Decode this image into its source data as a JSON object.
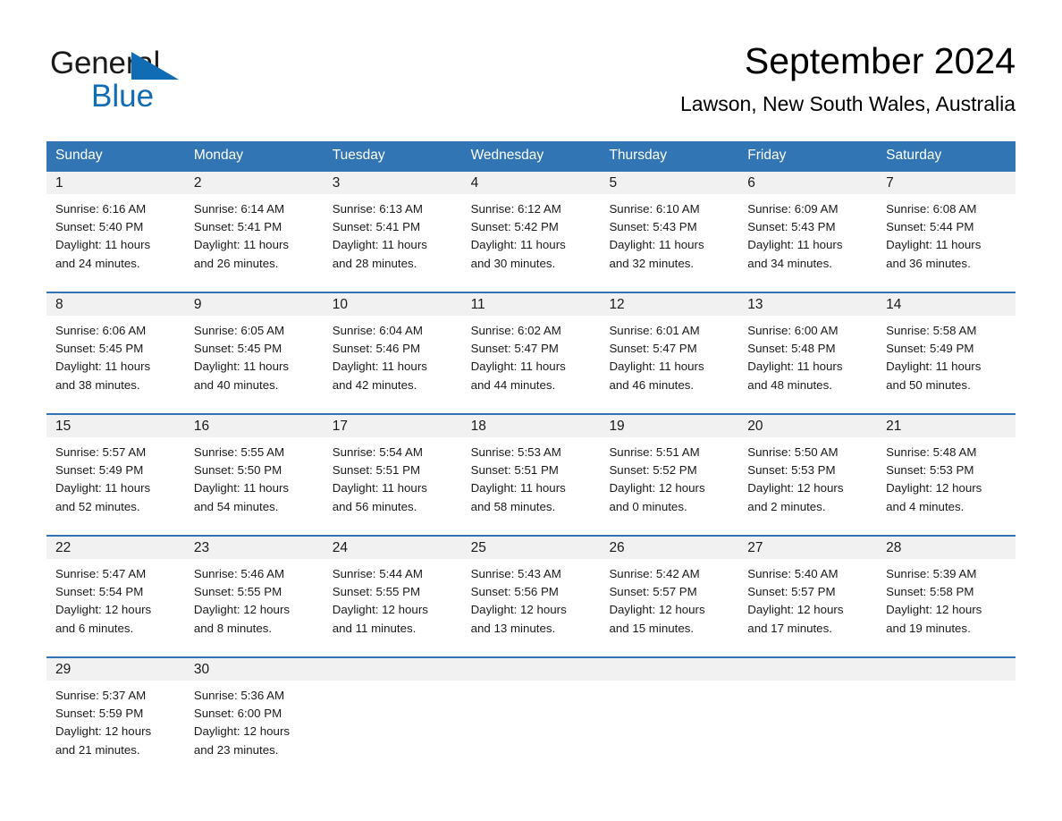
{
  "brand": {
    "name_part1": "General",
    "name_part2": "Blue",
    "triangle_icon": "triangle-icon",
    "accent_color": "#0f6cb5"
  },
  "header": {
    "title": "September 2024",
    "subtitle": "Lawson, New South Wales, Australia"
  },
  "theme": {
    "header_blue": "#3275b4",
    "daynum_band": "#f1f1f1",
    "text": "#1a1a1a"
  },
  "weekdays": [
    "Sunday",
    "Monday",
    "Tuesday",
    "Wednesday",
    "Thursday",
    "Friday",
    "Saturday"
  ],
  "weeks": [
    {
      "days": [
        {
          "num": "1",
          "sunrise": "Sunrise: 6:16 AM",
          "sunset": "Sunset: 5:40 PM",
          "daylight1": "Daylight: 11 hours",
          "daylight2": "and 24 minutes."
        },
        {
          "num": "2",
          "sunrise": "Sunrise: 6:14 AM",
          "sunset": "Sunset: 5:41 PM",
          "daylight1": "Daylight: 11 hours",
          "daylight2": "and 26 minutes."
        },
        {
          "num": "3",
          "sunrise": "Sunrise: 6:13 AM",
          "sunset": "Sunset: 5:41 PM",
          "daylight1": "Daylight: 11 hours",
          "daylight2": "and 28 minutes."
        },
        {
          "num": "4",
          "sunrise": "Sunrise: 6:12 AM",
          "sunset": "Sunset: 5:42 PM",
          "daylight1": "Daylight: 11 hours",
          "daylight2": "and 30 minutes."
        },
        {
          "num": "5",
          "sunrise": "Sunrise: 6:10 AM",
          "sunset": "Sunset: 5:43 PM",
          "daylight1": "Daylight: 11 hours",
          "daylight2": "and 32 minutes."
        },
        {
          "num": "6",
          "sunrise": "Sunrise: 6:09 AM",
          "sunset": "Sunset: 5:43 PM",
          "daylight1": "Daylight: 11 hours",
          "daylight2": "and 34 minutes."
        },
        {
          "num": "7",
          "sunrise": "Sunrise: 6:08 AM",
          "sunset": "Sunset: 5:44 PM",
          "daylight1": "Daylight: 11 hours",
          "daylight2": "and 36 minutes."
        }
      ]
    },
    {
      "days": [
        {
          "num": "8",
          "sunrise": "Sunrise: 6:06 AM",
          "sunset": "Sunset: 5:45 PM",
          "daylight1": "Daylight: 11 hours",
          "daylight2": "and 38 minutes."
        },
        {
          "num": "9",
          "sunrise": "Sunrise: 6:05 AM",
          "sunset": "Sunset: 5:45 PM",
          "daylight1": "Daylight: 11 hours",
          "daylight2": "and 40 minutes."
        },
        {
          "num": "10",
          "sunrise": "Sunrise: 6:04 AM",
          "sunset": "Sunset: 5:46 PM",
          "daylight1": "Daylight: 11 hours",
          "daylight2": "and 42 minutes."
        },
        {
          "num": "11",
          "sunrise": "Sunrise: 6:02 AM",
          "sunset": "Sunset: 5:47 PM",
          "daylight1": "Daylight: 11 hours",
          "daylight2": "and 44 minutes."
        },
        {
          "num": "12",
          "sunrise": "Sunrise: 6:01 AM",
          "sunset": "Sunset: 5:47 PM",
          "daylight1": "Daylight: 11 hours",
          "daylight2": "and 46 minutes."
        },
        {
          "num": "13",
          "sunrise": "Sunrise: 6:00 AM",
          "sunset": "Sunset: 5:48 PM",
          "daylight1": "Daylight: 11 hours",
          "daylight2": "and 48 minutes."
        },
        {
          "num": "14",
          "sunrise": "Sunrise: 5:58 AM",
          "sunset": "Sunset: 5:49 PM",
          "daylight1": "Daylight: 11 hours",
          "daylight2": "and 50 minutes."
        }
      ]
    },
    {
      "days": [
        {
          "num": "15",
          "sunrise": "Sunrise: 5:57 AM",
          "sunset": "Sunset: 5:49 PM",
          "daylight1": "Daylight: 11 hours",
          "daylight2": "and 52 minutes."
        },
        {
          "num": "16",
          "sunrise": "Sunrise: 5:55 AM",
          "sunset": "Sunset: 5:50 PM",
          "daylight1": "Daylight: 11 hours",
          "daylight2": "and 54 minutes."
        },
        {
          "num": "17",
          "sunrise": "Sunrise: 5:54 AM",
          "sunset": "Sunset: 5:51 PM",
          "daylight1": "Daylight: 11 hours",
          "daylight2": "and 56 minutes."
        },
        {
          "num": "18",
          "sunrise": "Sunrise: 5:53 AM",
          "sunset": "Sunset: 5:51 PM",
          "daylight1": "Daylight: 11 hours",
          "daylight2": "and 58 minutes."
        },
        {
          "num": "19",
          "sunrise": "Sunrise: 5:51 AM",
          "sunset": "Sunset: 5:52 PM",
          "daylight1": "Daylight: 12 hours",
          "daylight2": "and 0 minutes."
        },
        {
          "num": "20",
          "sunrise": "Sunrise: 5:50 AM",
          "sunset": "Sunset: 5:53 PM",
          "daylight1": "Daylight: 12 hours",
          "daylight2": "and 2 minutes."
        },
        {
          "num": "21",
          "sunrise": "Sunrise: 5:48 AM",
          "sunset": "Sunset: 5:53 PM",
          "daylight1": "Daylight: 12 hours",
          "daylight2": "and 4 minutes."
        }
      ]
    },
    {
      "days": [
        {
          "num": "22",
          "sunrise": "Sunrise: 5:47 AM",
          "sunset": "Sunset: 5:54 PM",
          "daylight1": "Daylight: 12 hours",
          "daylight2": "and 6 minutes."
        },
        {
          "num": "23",
          "sunrise": "Sunrise: 5:46 AM",
          "sunset": "Sunset: 5:55 PM",
          "daylight1": "Daylight: 12 hours",
          "daylight2": "and 8 minutes."
        },
        {
          "num": "24",
          "sunrise": "Sunrise: 5:44 AM",
          "sunset": "Sunset: 5:55 PM",
          "daylight1": "Daylight: 12 hours",
          "daylight2": "and 11 minutes."
        },
        {
          "num": "25",
          "sunrise": "Sunrise: 5:43 AM",
          "sunset": "Sunset: 5:56 PM",
          "daylight1": "Daylight: 12 hours",
          "daylight2": "and 13 minutes."
        },
        {
          "num": "26",
          "sunrise": "Sunrise: 5:42 AM",
          "sunset": "Sunset: 5:57 PM",
          "daylight1": "Daylight: 12 hours",
          "daylight2": "and 15 minutes."
        },
        {
          "num": "27",
          "sunrise": "Sunrise: 5:40 AM",
          "sunset": "Sunset: 5:57 PM",
          "daylight1": "Daylight: 12 hours",
          "daylight2": "and 17 minutes."
        },
        {
          "num": "28",
          "sunrise": "Sunrise: 5:39 AM",
          "sunset": "Sunset: 5:58 PM",
          "daylight1": "Daylight: 12 hours",
          "daylight2": "and 19 minutes."
        }
      ]
    },
    {
      "days": [
        {
          "num": "29",
          "sunrise": "Sunrise: 5:37 AM",
          "sunset": "Sunset: 5:59 PM",
          "daylight1": "Daylight: 12 hours",
          "daylight2": "and 21 minutes."
        },
        {
          "num": "30",
          "sunrise": "Sunrise: 5:36 AM",
          "sunset": "Sunset: 6:00 PM",
          "daylight1": "Daylight: 12 hours",
          "daylight2": "and 23 minutes."
        },
        {
          "num": "",
          "sunrise": "",
          "sunset": "",
          "daylight1": "",
          "daylight2": ""
        },
        {
          "num": "",
          "sunrise": "",
          "sunset": "",
          "daylight1": "",
          "daylight2": ""
        },
        {
          "num": "",
          "sunrise": "",
          "sunset": "",
          "daylight1": "",
          "daylight2": ""
        },
        {
          "num": "",
          "sunrise": "",
          "sunset": "",
          "daylight1": "",
          "daylight2": ""
        },
        {
          "num": "",
          "sunrise": "",
          "sunset": "",
          "daylight1": "",
          "daylight2": ""
        }
      ]
    }
  ]
}
